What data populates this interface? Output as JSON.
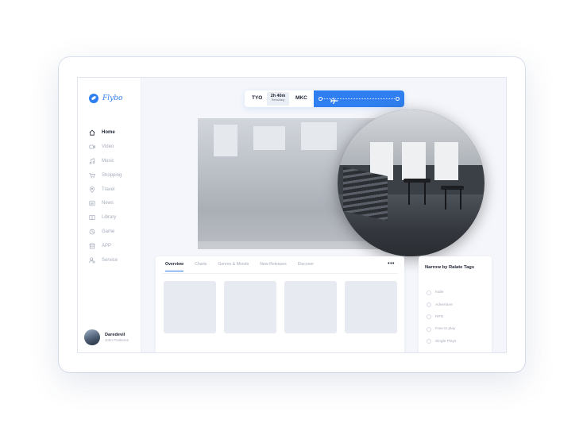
{
  "app": {
    "name": "Flybo"
  },
  "sidebar": {
    "items": [
      {
        "label": "Home",
        "icon": "home-icon",
        "active": true
      },
      {
        "label": "Video",
        "icon": "video-icon"
      },
      {
        "label": "Music",
        "icon": "music-icon"
      },
      {
        "label": "Shopping",
        "icon": "cart-icon"
      },
      {
        "label": "Travel",
        "icon": "location-pin-icon"
      },
      {
        "label": "News",
        "icon": "news-icon"
      },
      {
        "label": "Library",
        "icon": "book-icon"
      },
      {
        "label": "Game",
        "icon": "gamepad-icon"
      },
      {
        "label": "APP",
        "icon": "store-icon"
      },
      {
        "label": "Service",
        "icon": "user-service-icon"
      }
    ],
    "user": {
      "name": "Daredevil",
      "subtitle": "John Foolsons"
    }
  },
  "flight": {
    "from": "TYO",
    "to": "MKC",
    "duration": "2h 40m",
    "duration_label": "Remaining",
    "accent": "#2f7ff0"
  },
  "content": {
    "tabs": [
      "Overview",
      "Charts",
      "Genres & Moods",
      "New Releases",
      "Discover"
    ],
    "active_tab": "Overview",
    "more_label": "•••"
  },
  "tags_panel": {
    "title": "Narrow by Ralate Tags",
    "options": [
      "Indie",
      "Adventure",
      "RPG",
      "Free to play",
      "Single Plays"
    ]
  }
}
